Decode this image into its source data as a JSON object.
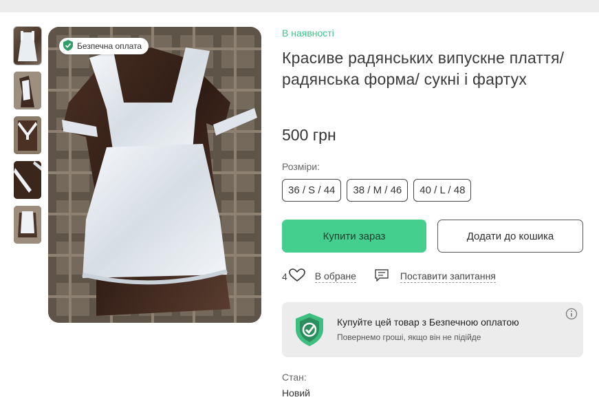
{
  "badge": {
    "safe_payment": "Безпечна оплата"
  },
  "product": {
    "availability": "В наявності",
    "title": "Красиве радянських випускне плаття/ радянська форма/ сукні і фартух",
    "price": "500 грн",
    "sizes_label": "Розміри:",
    "sizes": [
      "36 / S / 44",
      "38 / M / 46",
      "40 / L / 48"
    ],
    "buy_now": "Купити зараз",
    "add_to_cart": "Додати до кошика",
    "favorites_count": "4",
    "favorites_label": "В обране",
    "ask_label": "Поставити запитання",
    "condition_label": "Стан:",
    "condition_value": "Новий"
  },
  "safe_card": {
    "title": "Купуйте цей товар з Безпечною оплатою",
    "subtitle": "Повернемо гроші, якщо він не підійде"
  },
  "colors": {
    "accent_green": "#45cf8f",
    "availability_green": "#3cc68a",
    "card_bg": "#ececec"
  },
  "icons": [
    "shield-check-icon",
    "heart-icon",
    "chat-icon",
    "info-icon"
  ],
  "thumbnails_count": 5
}
